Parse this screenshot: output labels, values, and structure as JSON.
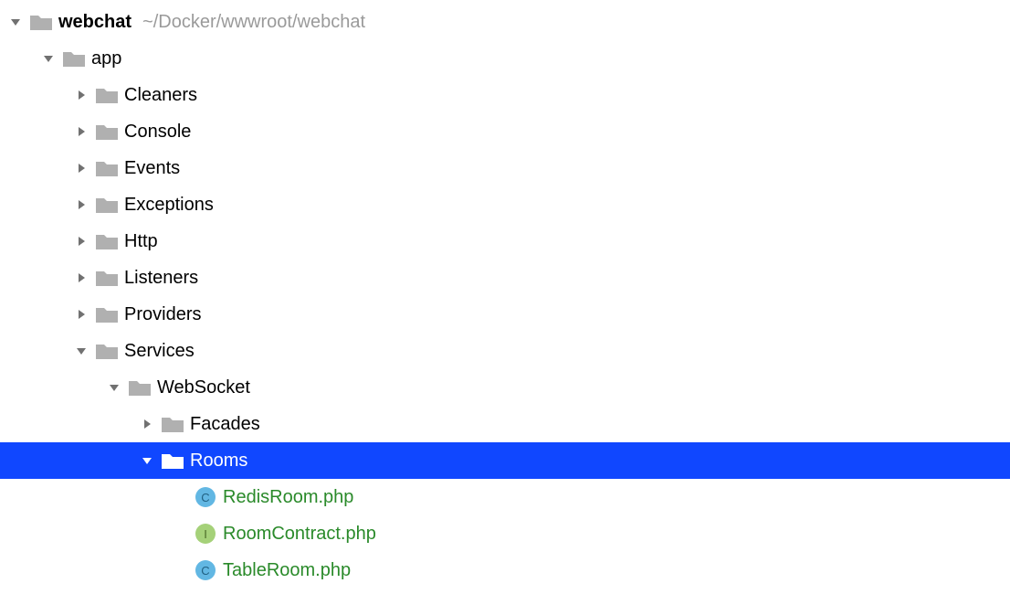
{
  "root": {
    "name": "webchat",
    "path": "~/Docker/wwwroot/webchat"
  },
  "folders": {
    "app": "app",
    "cleaners": "Cleaners",
    "console": "Console",
    "events": "Events",
    "exceptions": "Exceptions",
    "http": "Http",
    "listeners": "Listeners",
    "providers": "Providers",
    "services": "Services",
    "websocket": "WebSocket",
    "facades": "Facades",
    "rooms": "Rooms"
  },
  "files": {
    "redisroom": "RedisRoom.php",
    "roomcontract": "RoomContract.php",
    "tableroom": "TableRoom.php"
  },
  "icon_letters": {
    "class": "C",
    "interface": "I"
  }
}
